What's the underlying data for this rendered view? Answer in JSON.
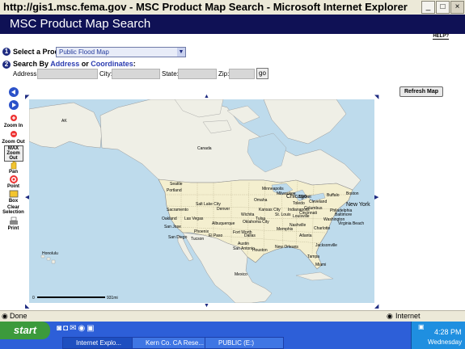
{
  "window": {
    "title": "http://gis1.msc.fema.gov - MSC Product Map Search - Microsoft Internet Explorer",
    "buttons": [
      "_",
      "□",
      "×"
    ]
  },
  "app": {
    "header": "MSC Product Map Search",
    "help": "HELP?"
  },
  "form": {
    "step1_number": "1",
    "step1_label": "Select a Product:",
    "product_selected": "Public Flood Map",
    "step2_number": "2",
    "step2_prefix": "Search By",
    "step2_address_link": "Address",
    "step2_or": "or",
    "step2_coords_link": "Coordinates",
    "step2_colon": ":",
    "address_label": "Address:",
    "address_value": "",
    "city_label": "City:",
    "city_value": "",
    "state_label": "State:",
    "state_value": "",
    "zip_label": "Zip:",
    "zip_value": "",
    "go_label": "go"
  },
  "toolbar": {
    "zoom_in": "Zoom In",
    "zoom_out": "Zoom Out",
    "max_zoom_out": "MAX Zoom Out",
    "pan": "Pan",
    "point": "Point",
    "box": "Box",
    "clear_selection": "Clear Selection",
    "print": "Print"
  },
  "refresh_label": "Refresh Map",
  "map": {
    "scale_start": "0",
    "scale_end": "931mi",
    "labels": {
      "ak": "AK",
      "canada": "Canada",
      "mexico": "Mexico",
      "honolulu": "Honolulu",
      "seattle": "Seattle",
      "portland": "Portland",
      "sacramento": "Sacramento",
      "oakland": "Oakland",
      "san_jose": "San Jose",
      "san_diego": "San Diego",
      "phoenix": "Phoenix",
      "las_vegas": "Las Vegas",
      "salt_lake_city": "Salt Lake City",
      "denver": "Denver",
      "albuquerque": "Albuquerque",
      "el_paso": "El Paso",
      "tucson": "Tucson",
      "dallas": "Dallas",
      "houston": "Houston",
      "austin": "Austin",
      "san_antonio": "San Antonio",
      "fort_worth": "Fort Worth",
      "wichita": "Wichita",
      "kansas_city": "Kansas City",
      "omaha": "Omaha",
      "oklahoma_city": "Oklahoma City",
      "tulsa": "Tulsa",
      "minneapolis": "Minneapolis",
      "milwaukee": "Milwaukee",
      "chicago": "Chicago",
      "detroit": "Detroit",
      "toledo": "Toledo",
      "columbus": "Columbus",
      "cleveland": "Cleveland",
      "buffalo": "Buffalo",
      "boston": "Boston",
      "new_york": "New York",
      "philadelphia": "Philadelphia",
      "baltimore": "Baltimore",
      "washington": "Washington",
      "virginia_beach": "Virginia Beach",
      "charlotte": "Charlotte",
      "nashville": "Nashville",
      "memphis": "Memphis",
      "atlanta": "Atlanta",
      "jacksonville": "Jacksonville",
      "st_louis": "St. Louis",
      "louisville": "Louisville",
      "indianapolis": "Indianapolis",
      "cincinnati": "Cincinnati",
      "new_orleans": "New Orleans",
      "miami": "Miami",
      "tampa": "Tampa"
    }
  },
  "status": {
    "left": "Done",
    "right": "Internet"
  },
  "taskbar": {
    "start": "start",
    "tasks": [
      "Internet Explo...",
      "Kern Co. CA Rese...",
      "PUBLIC (E:)"
    ],
    "time": "4:28 PM",
    "day": "Wednesday"
  }
}
